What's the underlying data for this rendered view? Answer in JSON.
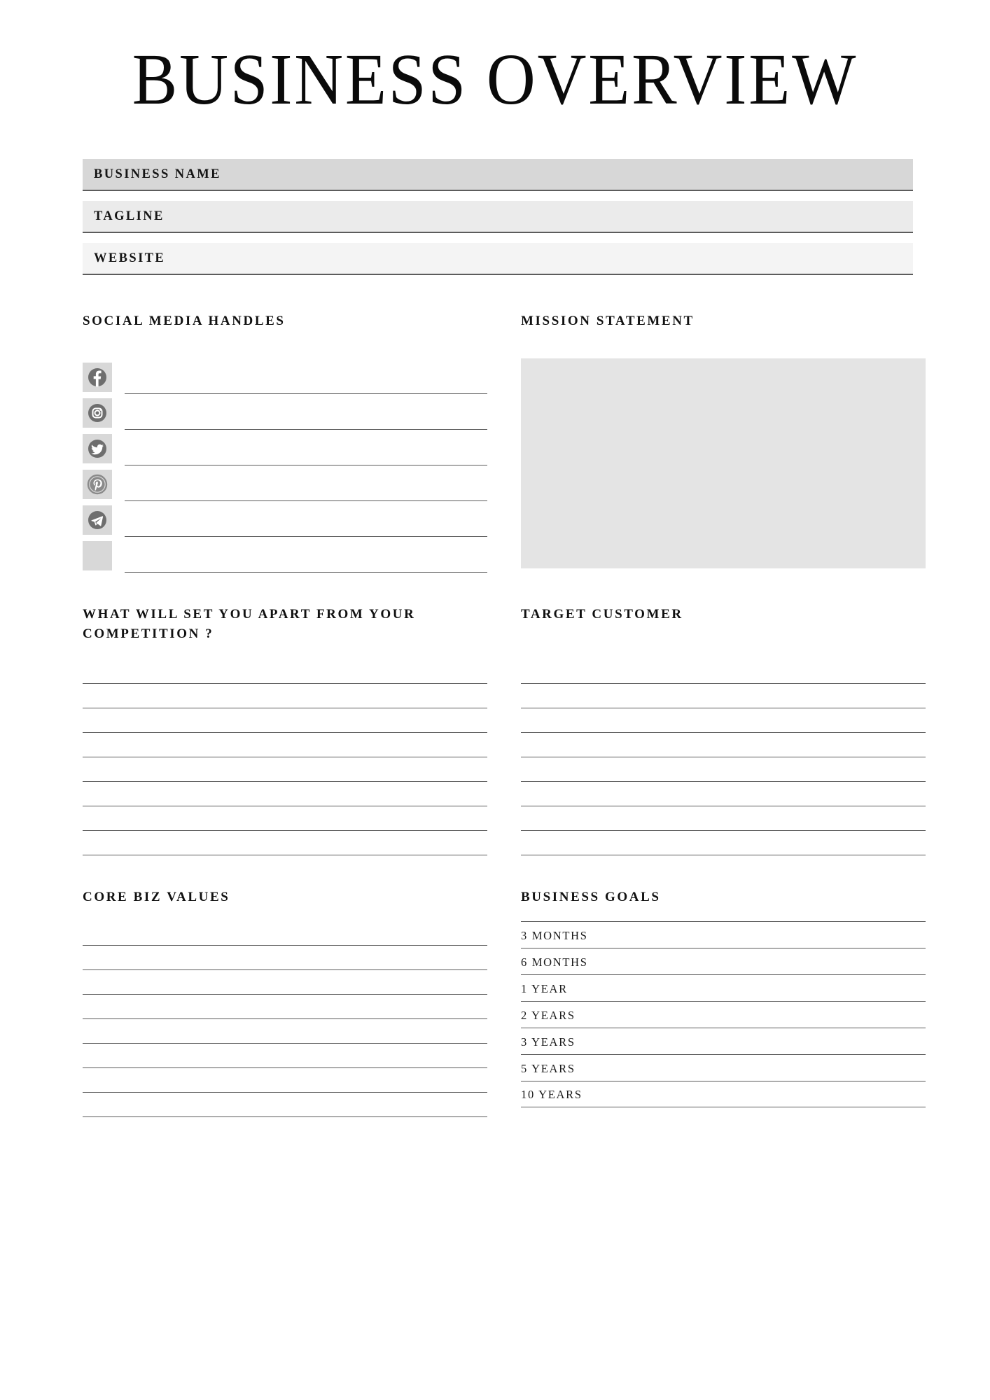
{
  "document": {
    "title": "BUSINESS OVERVIEW"
  },
  "fields": [
    {
      "label": "BUSINESS NAME",
      "value": "",
      "shade": "#d7d7d7"
    },
    {
      "label": "TAGLINE",
      "value": "",
      "shade": "#ebebeb"
    },
    {
      "label": "WEBSITE",
      "value": "",
      "shade": "#f4f4f4"
    }
  ],
  "social": {
    "heading": "SOCIAL MEDIA HANDLES",
    "rows": [
      {
        "icon": "facebook-icon",
        "value": ""
      },
      {
        "icon": "instagram-icon",
        "value": ""
      },
      {
        "icon": "twitter-icon",
        "value": ""
      },
      {
        "icon": "pinterest-icon",
        "value": ""
      },
      {
        "icon": "telegram-icon",
        "value": ""
      },
      {
        "icon": "blank-icon",
        "value": ""
      }
    ]
  },
  "mission": {
    "heading": "MISSION STATEMENT",
    "value": ""
  },
  "competition": {
    "heading": "WHAT WILL SET YOU APART FROM YOUR COMPETITION ?",
    "line_count": 8
  },
  "target_customer": {
    "heading": "TARGET CUSTOMER",
    "line_count": 8
  },
  "core_values": {
    "heading": "CORE BIZ VALUES",
    "line_count": 8
  },
  "business_goals": {
    "heading": "BUSINESS GOALS",
    "rows": [
      {
        "period": "3 MONTHS",
        "value": ""
      },
      {
        "period": "6 MONTHS",
        "value": ""
      },
      {
        "period": "1 YEAR",
        "value": ""
      },
      {
        "period": "2 YEARS",
        "value": ""
      },
      {
        "period": "3 YEARS",
        "value": ""
      },
      {
        "period": "5 YEARS",
        "value": ""
      },
      {
        "period": "10 YEARS",
        "value": ""
      }
    ]
  },
  "colors": {
    "page_background": "#ffffff",
    "bar_dark": "#d7d7d7",
    "bar_mid": "#ebebeb",
    "bar_light": "#f4f4f4",
    "rule": "#5a5a5a",
    "mission_box": "#e4e4e4",
    "icon_tile": "#d8d8d8",
    "icon_glyph": "#6e6e6e",
    "text": "#111111"
  }
}
